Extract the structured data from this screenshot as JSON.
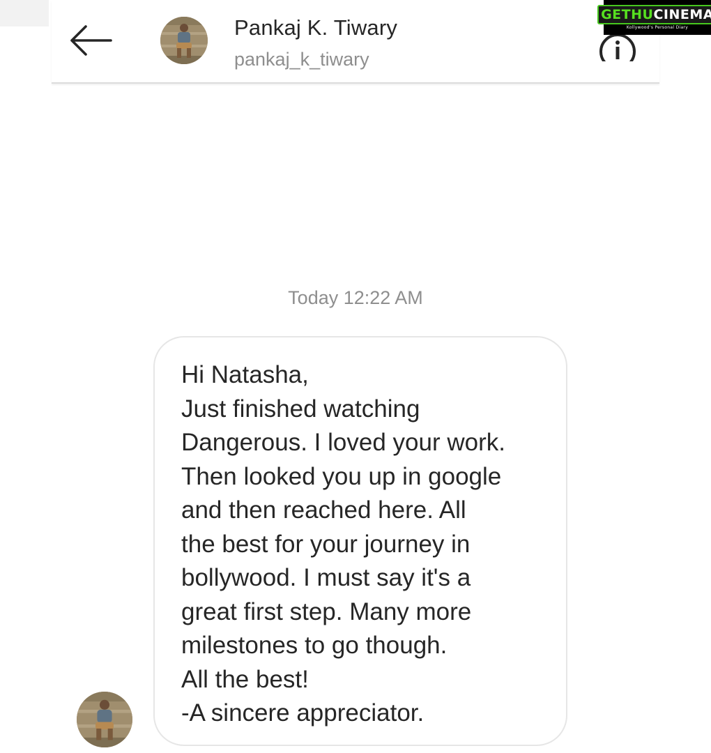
{
  "header": {
    "contact_name": "Pankaj K. Tiwary",
    "username": "pankaj_k_tiwary",
    "back_icon": "arrow-left-icon",
    "info_icon": "info-circle-icon",
    "avatar_icon": "profile-photo"
  },
  "watermark": {
    "word1": "GETHU",
    "word2": "CINEMA",
    "tagline": "Kollywood's Personal Diary"
  },
  "thread": {
    "timestamp": "Today 12:22 AM",
    "message": "Hi Natasha,\nJust finished watching\nDangerous. I loved your work.\nThen looked you up in google\nand then reached here. All\nthe best for your journey in\nbollywood. I must say it's a\ngreat first step. Many more\nmilestones to go though.\nAll the best!\n-A sincere appreciator."
  },
  "colors": {
    "text_primary": "#262626",
    "text_secondary": "#8e8e8e",
    "bubble_border": "#e6e6e6",
    "logo_green": "#57e020"
  }
}
